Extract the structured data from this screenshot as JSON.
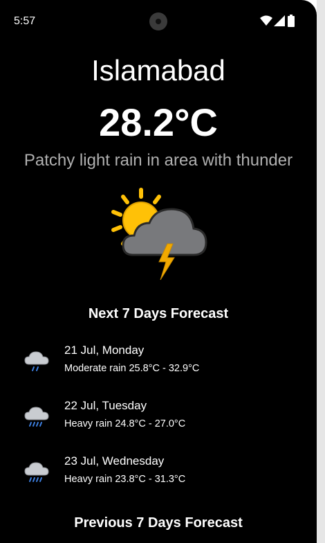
{
  "status_bar": {
    "time": "5:57"
  },
  "current": {
    "city": "Islamabad",
    "temperature": "28.2°C",
    "condition": "Patchy light rain in area with thunder",
    "icon": "sun-cloud-thunder-icon"
  },
  "forecast_title": "Next 7 Days Forecast",
  "forecast": [
    {
      "date": "21 Jul, Monday",
      "description": "Moderate rain 25.8°C - 32.9°C",
      "icon": "rain-cloud-icon"
    },
    {
      "date": "22 Jul, Tuesday",
      "description": "Heavy rain 24.8°C - 27.0°C",
      "icon": "heavy-rain-cloud-icon"
    },
    {
      "date": "23 Jul, Wednesday",
      "description": "Heavy rain 23.8°C - 31.3°C",
      "icon": "heavy-rain-cloud-icon"
    }
  ],
  "previous_title": "Previous 7 Days Forecast",
  "colors": {
    "background": "#000000",
    "text": "#ffffff",
    "muted_text": "#b0b0b0",
    "sun": "#ffc107",
    "cloud": "#78797c",
    "bolt": "#f2a900",
    "rain": "#3d7fe0"
  }
}
